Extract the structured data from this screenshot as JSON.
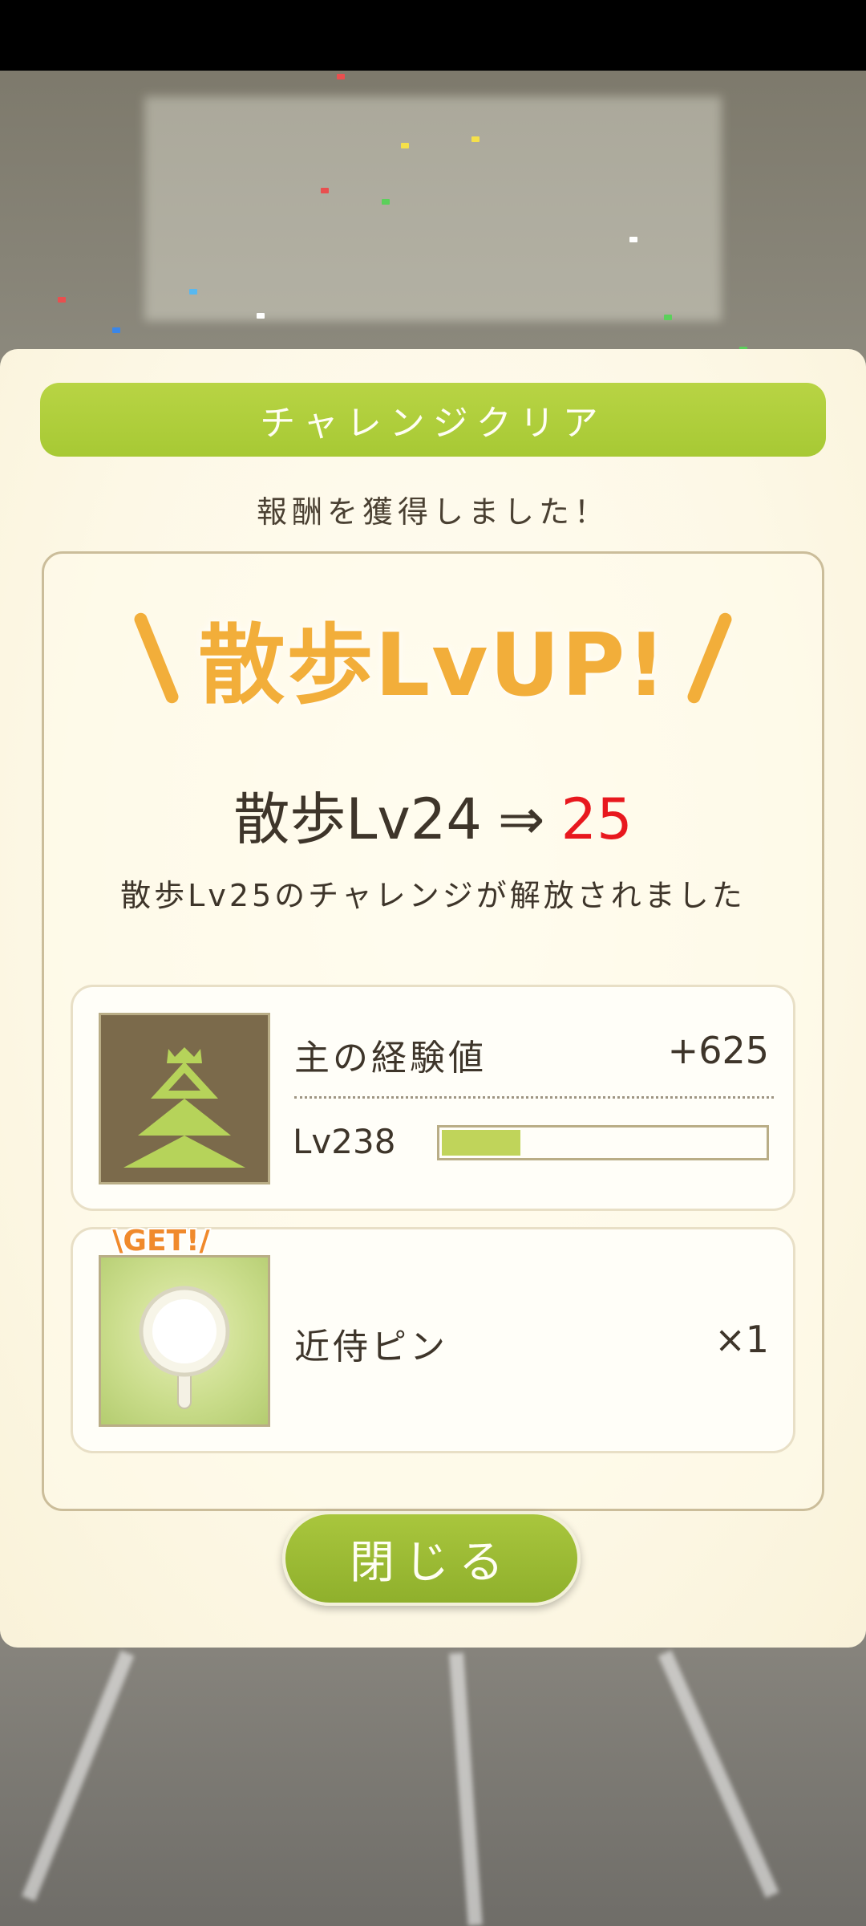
{
  "dialog": {
    "header_title": "チャレンジクリア",
    "subtitle": "報酬を獲得しました！",
    "banner": "散歩LvUP!",
    "level_prefix": "散歩Lv24",
    "level_arrow": "⇒",
    "level_new": "25",
    "unlock_message": "散歩Lv25のチャレンジが解放されました",
    "close_button": "閉じる"
  },
  "rewards": {
    "exp": {
      "name": "主の経験値",
      "amount": "+625",
      "level": "Lv238",
      "progress": 0.24,
      "icon": "castle-icon"
    },
    "pin": {
      "badge": "\\GET!/",
      "name": "近侍ピン",
      "amount": "×1",
      "icon": "pin-icon"
    }
  },
  "colors": {
    "accent_green": "#a7c934",
    "banner_orange": "#f2ae3a",
    "level_red": "#e8181e"
  }
}
